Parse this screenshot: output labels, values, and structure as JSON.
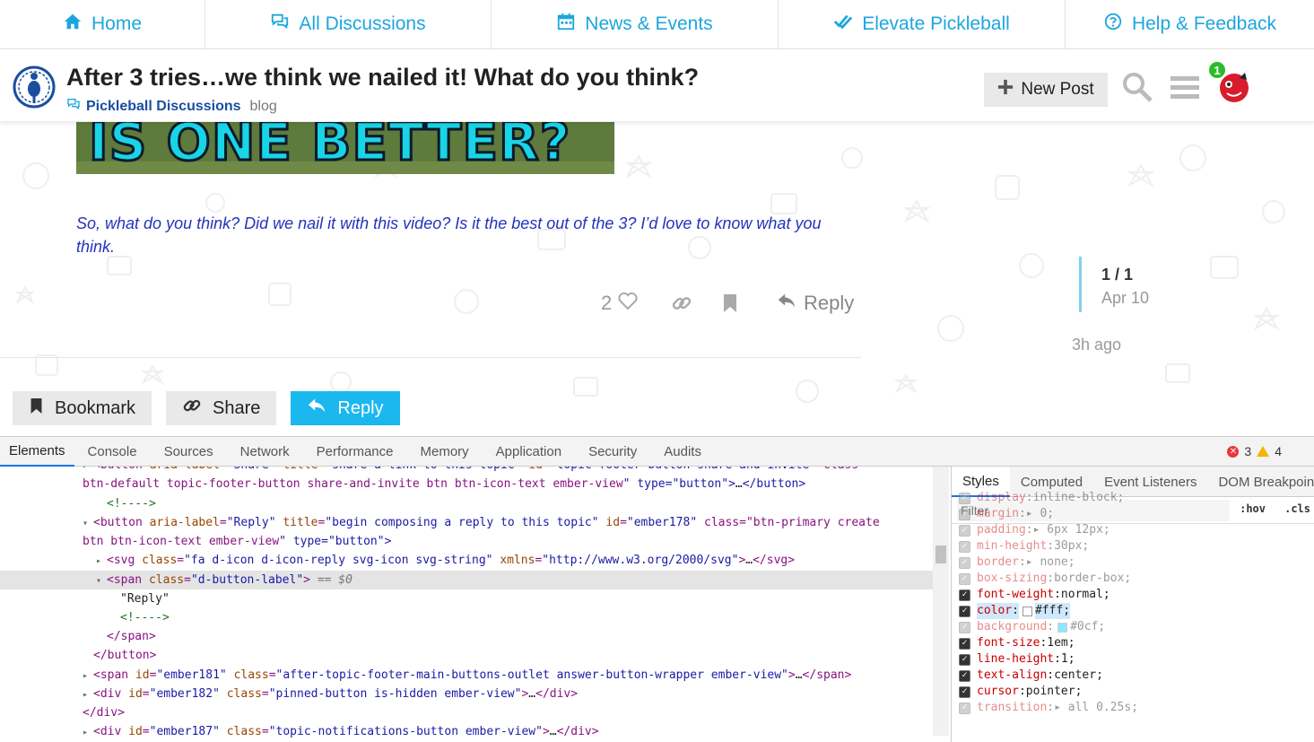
{
  "nav": {
    "items": [
      {
        "label": "Home",
        "icon": "home-icon"
      },
      {
        "label": "All Discussions",
        "icon": "comments-icon"
      },
      {
        "label": "News & Events",
        "icon": "calendar-icon"
      },
      {
        "label": "Elevate Pickleball",
        "icon": "check-double-icon"
      },
      {
        "label": "Help & Feedback",
        "icon": "question-circle-icon"
      }
    ],
    "color": "#1ca6de"
  },
  "header": {
    "title": "After 3 tries…we think we nailed it! What do you think?",
    "category": "Pickleball Discussions",
    "tag": "blog",
    "new_post_label": "New Post",
    "notification_count": "1"
  },
  "post": {
    "image_text": "IS ONE BETTER?",
    "text": "So, what do you think? Did we nail it with this video? Is it the best out of the 3? I’d love to know what you think.",
    "likes": "2",
    "reply_label": "Reply"
  },
  "timeline": {
    "count": "1 / 1",
    "date": "Apr 10",
    "ago": "3h ago"
  },
  "footer_buttons": {
    "bookmark": "Bookmark",
    "share": "Share",
    "reply": "Reply"
  },
  "devtools": {
    "tabs": [
      "Elements",
      "Console",
      "Sources",
      "Network",
      "Performance",
      "Memory",
      "Application",
      "Security",
      "Audits"
    ],
    "errors": "3",
    "warnings": "4",
    "styles_tabs": [
      "Styles",
      "Computed",
      "Event Listeners",
      "DOM Breakpoints"
    ],
    "filter_placeholder": "Filter",
    "hov": ":hov",
    "cls": ".cls",
    "css_rules": [
      {
        "prop": "display",
        "val": "inline-block;",
        "on": false
      },
      {
        "prop": "margin",
        "val": "▸ 0;",
        "on": false
      },
      {
        "prop": "padding",
        "val": "▸ 6px 12px;",
        "on": false
      },
      {
        "prop": "min-height",
        "val": "30px;",
        "on": false
      },
      {
        "prop": "border",
        "val": "▸ none;",
        "on": false
      },
      {
        "prop": "box-sizing",
        "val": "border-box;",
        "on": false
      },
      {
        "prop": "font-weight",
        "val": "normal;",
        "on": true
      },
      {
        "prop": "color",
        "val": "#fff;",
        "on": true,
        "swatch": "#ffffff",
        "highlight": true
      },
      {
        "prop": "background",
        "val": "#0cf;",
        "on": false,
        "swatch": "#00ccff"
      },
      {
        "prop": "font-size",
        "val": "1em;",
        "on": true
      },
      {
        "prop": "line-height",
        "val": "1;",
        "on": true
      },
      {
        "prop": "text-align",
        "val": "center;",
        "on": true
      },
      {
        "prop": "cursor",
        "val": "pointer;",
        "on": true
      },
      {
        "prop": "transition",
        "val": "▸ all 0.25s;",
        "on": false
      }
    ]
  },
  "dom_lines": [
    {
      "indent": 0,
      "arrow": "▸",
      "html": "<button aria-label=\"Share\" title=\"share a link to this topic\" id=\"topic-footer-button-share-and-invite\" class=\""
    },
    {
      "indent": 0,
      "arrow": "",
      "html": "btn-default topic-footer-button share-and-invite btn btn-icon-text ember-view\" type=\"button\">…</button>"
    },
    {
      "indent": 1,
      "arrow": "",
      "html": "<!---->"
    },
    {
      "indent": 0,
      "arrow": "▾",
      "html": "<button aria-label=\"Reply\" title=\"begin composing a reply to this topic\" id=\"ember178\" class=\"btn-primary create"
    },
    {
      "indent": 0,
      "arrow": "",
      "html": "btn btn-icon-text ember-view\" type=\"button\">"
    },
    {
      "indent": 1,
      "arrow": "▸",
      "html": "<svg class=\"fa d-icon d-icon-reply svg-icon svg-string\" xmlns=\"http://www.w3.org/2000/svg\">…</svg>"
    },
    {
      "indent": 1,
      "arrow": "▾",
      "html": "<span class=\"d-button-label\"> == $0"
    },
    {
      "indent": 2,
      "arrow": "",
      "html": "\"Reply\""
    },
    {
      "indent": 2,
      "arrow": "",
      "html": "<!---->"
    },
    {
      "indent": 1,
      "arrow": "",
      "html": "</span>"
    },
    {
      "indent": 0,
      "arrow": "",
      "html": "</button>"
    },
    {
      "indent": 0,
      "arrow": "▸",
      "html": "<span id=\"ember181\" class=\"after-topic-footer-main-buttons-outlet answer-button-wrapper ember-view\">…</span>"
    },
    {
      "indent": 0,
      "arrow": "▸",
      "html": "<div id=\"ember182\" class=\"pinned-button is-hidden ember-view\">…</div>"
    },
    {
      "indent": 0,
      "arrow": "",
      "html": "</div>"
    },
    {
      "indent": 0,
      "arrow": "▸",
      "html": "<div id=\"ember187\" class=\"topic-notifications-button ember-view\">…</div>"
    }
  ]
}
